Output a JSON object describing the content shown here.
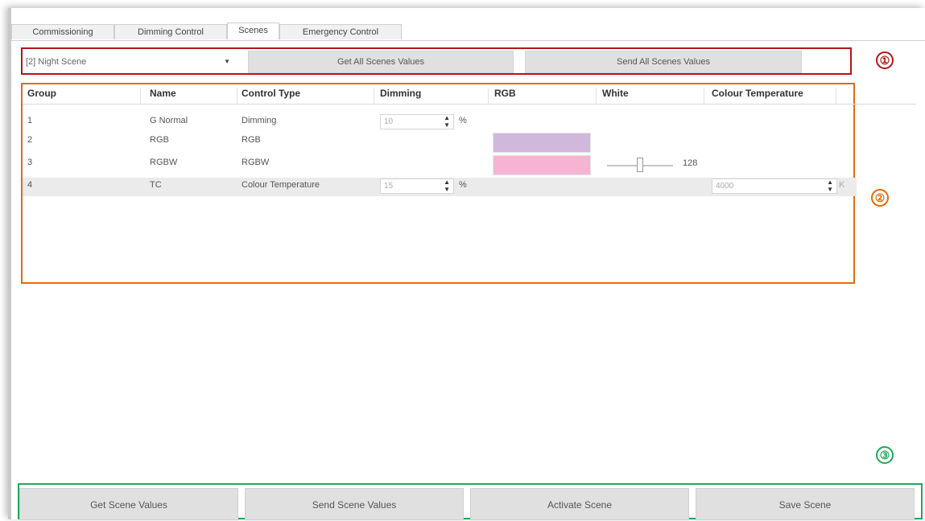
{
  "tabs": [
    "Commissioning",
    "Dimming Control",
    "Scenes",
    "Emergency Control"
  ],
  "active_tab": "Scenes",
  "toolbar": {
    "scene_select": "[2] Night Scene",
    "get_all": "Get All Scenes Values",
    "send_all": "Send All Scenes Values"
  },
  "table": {
    "headers": [
      "Group",
      "Name",
      "Control Type",
      "Dimming",
      "RGB",
      "White",
      "Colour Temperature"
    ],
    "rows": [
      {
        "group": "1",
        "name": "G Normal",
        "type": "Dimming",
        "dimming": "10",
        "unit": "%"
      },
      {
        "group": "2",
        "name": "RGB",
        "type": "RGB",
        "rgb_color": "#cfb8dc"
      },
      {
        "group": "3",
        "name": "RGBW",
        "type": "RGBW",
        "rgb_color": "#f6b4d2",
        "white": "128",
        "white_level": 0.5
      },
      {
        "group": "4",
        "name": "TC",
        "type": "Colour Temperature",
        "dimming": "15",
        "unit": "%",
        "colour_temp": "4000",
        "colour_temp_unit": "K"
      }
    ]
  },
  "annotations": [
    "①",
    "②",
    "③"
  ],
  "annotation_colors": {
    "1": "#b3151c",
    "2": "#e36c0a",
    "3": "#1fa85a"
  },
  "footer": {
    "get_scene": "Get Scene Values",
    "send_scene": "Send Scene Values",
    "activate": "Activate Scene",
    "save": "Save Scene"
  }
}
